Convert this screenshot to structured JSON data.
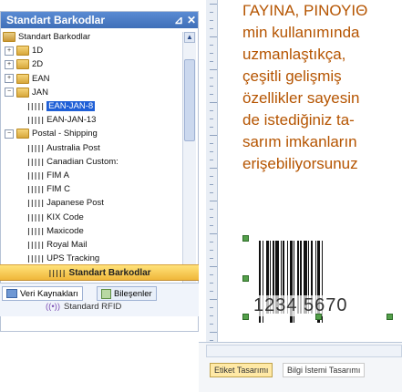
{
  "panel": {
    "title": "Standart Barkodlar",
    "pin_icon": "pin-icon",
    "close_icon": "close-icon",
    "tree": [
      {
        "label": "Standart Barkodlar",
        "level": 0,
        "expander": "",
        "type": "root"
      },
      {
        "label": "1D",
        "level": 1,
        "expander": "+",
        "type": "folder"
      },
      {
        "label": "2D",
        "level": 1,
        "expander": "+",
        "type": "folder"
      },
      {
        "label": "EAN",
        "level": 1,
        "expander": "+",
        "type": "folder"
      },
      {
        "label": "JAN",
        "level": 1,
        "expander": "−",
        "type": "folder"
      },
      {
        "label": "EAN-JAN-8",
        "level": 2,
        "expander": "",
        "type": "barcode",
        "selected": true
      },
      {
        "label": "EAN-JAN-13",
        "level": 2,
        "expander": "",
        "type": "barcode"
      },
      {
        "label": "Postal - Shipping",
        "level": 1,
        "expander": "−",
        "type": "folder"
      },
      {
        "label": "Australia Post",
        "level": 2,
        "expander": "",
        "type": "barcode"
      },
      {
        "label": "Canadian Custom:",
        "level": 2,
        "expander": "",
        "type": "barcode"
      },
      {
        "label": "FIM A",
        "level": 2,
        "expander": "",
        "type": "barcode"
      },
      {
        "label": "FIM C",
        "level": 2,
        "expander": "",
        "type": "barcode"
      },
      {
        "label": "Japanese Post",
        "level": 2,
        "expander": "",
        "type": "barcode"
      },
      {
        "label": "KIX Code",
        "level": 2,
        "expander": "",
        "type": "barcode"
      },
      {
        "label": "Maxicode",
        "level": 2,
        "expander": "",
        "type": "barcode"
      },
      {
        "label": "Royal Mail",
        "level": 2,
        "expander": "",
        "type": "barcode"
      },
      {
        "label": "UPS Tracking",
        "level": 2,
        "expander": "",
        "type": "barcode"
      }
    ],
    "std_bar_label": "Standart Barkodlar",
    "tab_veri": "Veri Kaynakları",
    "tab_bilesenler": "Bileşenler",
    "rfid_label": "Standard RFID"
  },
  "text_lines": [
    "ΓΑΥΙΝΑ, ΡΙΝΟΥΙΘ",
    "min kullanımında",
    "uzmanlaştıkça,",
    "çeşitli gelişmiş",
    "özellikler sayesin",
    "de istediğiniz ta-",
    "sarım imkanların",
    "erişebiliyorsunuz"
  ],
  "barcode": {
    "digits": "1234 5670"
  },
  "bottom_tabs": {
    "etiket": "Etiket Tasarımı",
    "bilgi": "Bilgi İstemi Tasarımı"
  },
  "colors": {
    "text_orange": "#b55400",
    "title_blue": "#3f6fb8",
    "selection": "#1f5fd6"
  }
}
